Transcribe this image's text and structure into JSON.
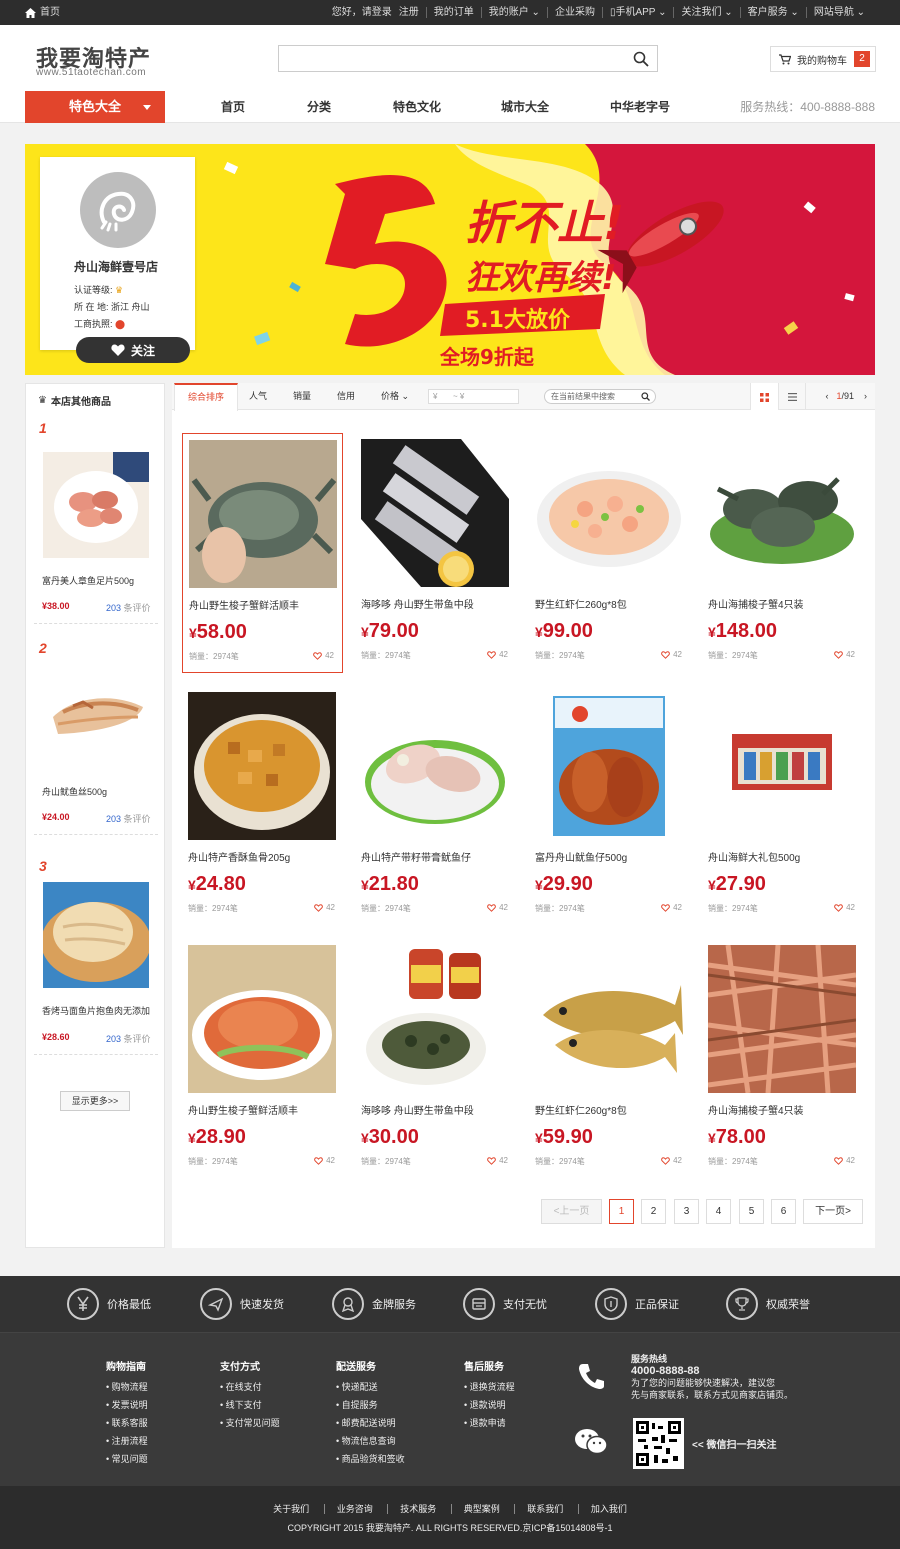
{
  "topbar": {
    "home": "首页",
    "links": [
      "您好，请登录",
      "注册",
      "我的订单",
      "我的账户",
      "企业采购",
      "手机APP",
      "关注我们",
      "客户服务",
      "网站导航"
    ]
  },
  "header": {
    "logo_text": "我要淘特产",
    "logo_sub": "www.51taotechan.com",
    "search_placeholder": "",
    "cart_label": "我的购物车",
    "cart_count": "2"
  },
  "nav": {
    "category": "特色大全",
    "items": [
      "首页",
      "分类",
      "特色文化",
      "城市大全",
      "中华老字号"
    ],
    "hotline": "服务热线：400-8888-888"
  },
  "banner": {
    "big_number": "5",
    "headline1": "折不止!",
    "headline2": "狂欢再续!",
    "ribbon": "5.1大放价",
    "sub": "全场9折起"
  },
  "shop": {
    "name": "舟山海鲜壹号店",
    "cert_label": "认证等级:",
    "location_label": "所 在 地:",
    "location": "浙江  舟山",
    "license_label": "工商执照:",
    "follow_label": "关注"
  },
  "sidebar": {
    "title": "本店其他商品",
    "items": [
      {
        "rank": "1",
        "name": "富丹美人章鱼足片500g",
        "price": "¥38.00",
        "reviews": "203",
        "reviews_label": "条评价"
      },
      {
        "rank": "2",
        "name": "舟山鱿鱼丝500g",
        "price": "¥24.00",
        "reviews": "203",
        "reviews_label": "条评价"
      },
      {
        "rank": "3",
        "name": "香烤马面鱼片抱鱼肉无添加",
        "price": "¥28.60",
        "reviews": "203",
        "reviews_label": "条评价"
      }
    ],
    "more": "显示更多>>"
  },
  "filter": {
    "tabs": [
      "综合排序",
      "人气",
      "销量",
      "信用",
      "价格"
    ],
    "price_from": "¥",
    "price_to": "~  ¥",
    "search_placeholder": "在当前结果中搜索",
    "page_current": "1",
    "page_total": "/91"
  },
  "products": [
    {
      "name": "舟山野生梭子蟹鲜活顺丰",
      "price": "58.00",
      "sales": "销量：2974笔",
      "likes": "42"
    },
    {
      "name": "海哆哆 舟山野生带鱼中段",
      "price": "79.00",
      "sales": "销量：2974笔",
      "likes": "42"
    },
    {
      "name": "野生红虾仁260g*8包",
      "price": "99.00",
      "sales": "销量：2974笔",
      "likes": "42"
    },
    {
      "name": "舟山海捕梭子蟹4只装",
      "price": "148.00",
      "sales": "销量：2974笔",
      "likes": "42"
    },
    {
      "name": "舟山特产香酥鱼骨205g",
      "price": "24.80",
      "sales": "销量：2974笔",
      "likes": "42"
    },
    {
      "name": "舟山特产带籽带膏鱿鱼仔",
      "price": "21.80",
      "sales": "销量：2974笔",
      "likes": "42"
    },
    {
      "name": "富丹舟山鱿鱼仔500g",
      "price": "29.90",
      "sales": "销量：2974笔",
      "likes": "42"
    },
    {
      "name": "舟山海鲜大礼包500g",
      "price": "27.90",
      "sales": "销量：2974笔",
      "likes": "42"
    },
    {
      "name": "舟山野生梭子蟹鲜活顺丰",
      "price": "28.90",
      "sales": "销量：2974笔",
      "likes": "42"
    },
    {
      "name": "海哆哆 舟山野生带鱼中段",
      "price": "30.00",
      "sales": "销量：2974笔",
      "likes": "42"
    },
    {
      "name": "野生红虾仁260g*8包",
      "price": "59.90",
      "sales": "销量：2974笔",
      "likes": "42"
    },
    {
      "name": "舟山海捕梭子蟹4只装",
      "price": "78.00",
      "sales": "销量：2974笔",
      "likes": "42"
    }
  ],
  "price_symbol": "¥",
  "pagination": {
    "prev": "<上一页",
    "pages": [
      "1",
      "2",
      "3",
      "4",
      "5",
      "6"
    ],
    "next": "下一页>"
  },
  "features": [
    "价格最低",
    "快速发货",
    "金牌服务",
    "支付无忧",
    "正品保证",
    "权威荣誉"
  ],
  "footer": {
    "columns": [
      {
        "title": "购物指南",
        "items": [
          "• 购物流程",
          "• 发票说明",
          "• 联系客服",
          "• 注册流程",
          "• 常见问题"
        ]
      },
      {
        "title": "支付方式",
        "items": [
          "• 在线支付",
          "• 线下支付",
          "• 支付常见问题"
        ]
      },
      {
        "title": "配送服务",
        "items": [
          "• 快递配送",
          "• 自提服务",
          "• 邮费配送说明",
          "• 物流信息查询",
          "• 商品验货和签收"
        ]
      },
      {
        "title": "售后服务",
        "items": [
          "• 退换货流程",
          "• 退款说明",
          "• 退款申请"
        ]
      }
    ],
    "hotline_title": "服务热线",
    "hotline_number": "4000-8888-88",
    "hotline_desc1": "为了您的问题能够快速解决，建议您",
    "hotline_desc2": "先与商家联系，联系方式见商家店铺页。",
    "wechat_text": "<< 微信扫一扫关注",
    "bottom_links": [
      "关于我们",
      "业务咨询",
      "技术服务",
      "典型案例",
      "联系我们",
      "加入我们"
    ],
    "copyright": "COPYRIGHT 2015 我要淘特产. ALL RIGHTS RESERVED.京ICP备15014808号-1"
  },
  "colors": {
    "accent": "#e2452c",
    "price": "#c81623",
    "dark": "#2d2d2d"
  }
}
